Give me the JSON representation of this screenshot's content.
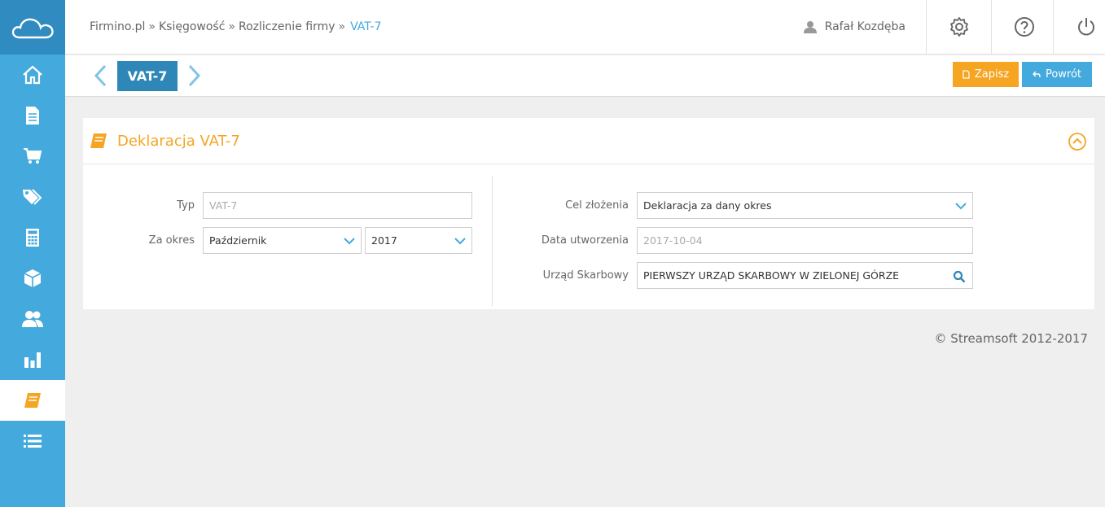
{
  "breadcrumb": {
    "items": [
      "Firmino.pl",
      "Księgowość",
      "Rozliczenie firmy"
    ],
    "separator": "»",
    "current": "VAT-7"
  },
  "user": {
    "name": "Rafał Kozdęba",
    "icon": "user-icon"
  },
  "topbar_icons": [
    "gear-icon",
    "help-icon",
    "power-icon"
  ],
  "sidebar": {
    "items": [
      {
        "icon": "home-icon"
      },
      {
        "icon": "document-icon"
      },
      {
        "icon": "cart-icon"
      },
      {
        "icon": "tags-icon"
      },
      {
        "icon": "calculator-icon"
      },
      {
        "icon": "cube-icon"
      },
      {
        "icon": "users-icon"
      },
      {
        "icon": "bar-chart-icon"
      },
      {
        "icon": "book-icon",
        "active": true
      },
      {
        "icon": "list-icon"
      }
    ]
  },
  "toolbar": {
    "document_label": "VAT-7",
    "save_label": "Zapisz",
    "back_label": "Powrót"
  },
  "panel": {
    "title": "Deklaracja VAT-7",
    "left": {
      "type_label": "Typ",
      "type_value": "VAT-7",
      "period_label": "Za okres",
      "month_value": "Październik",
      "year_value": "2017"
    },
    "right": {
      "purpose_label": "Cel złożenia",
      "purpose_value": "Deklaracja za dany okres",
      "created_label": "Data utworzenia",
      "created_value": "2017-10-04",
      "office_label": "Urząd Skarbowy",
      "office_value": "PIERWSZY URZĄD SKARBOWY W ZIELONEJ GÓRZE"
    }
  },
  "footer": {
    "copyright": "© Streamsoft 2012-2017"
  },
  "colors": {
    "primary": "#44a9dc",
    "dark_primary": "#2f87b8",
    "accent": "#f5a522"
  }
}
